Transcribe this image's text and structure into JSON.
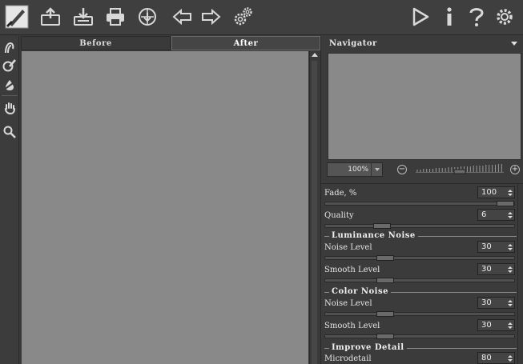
{
  "toolbar": {
    "buttons": [
      {
        "name": "app-logo-icon"
      },
      {
        "name": "open-icon"
      },
      {
        "name": "save-icon"
      },
      {
        "name": "print-icon"
      },
      {
        "name": "share-icon"
      },
      {
        "name": "undo-arrow-icon"
      },
      {
        "name": "redo-arrow-icon"
      },
      {
        "name": "settings-gears-icon"
      },
      {
        "name": "run-icon"
      },
      {
        "name": "info-icon"
      },
      {
        "name": "help-icon"
      },
      {
        "name": "preferences-icon"
      }
    ]
  },
  "tools": [
    "smudge-icon",
    "history-brush-icon",
    "eraser-icon",
    "hand-icon",
    "zoom-icon"
  ],
  "tabs": {
    "before": "Before",
    "after": "After"
  },
  "navigator": {
    "title": "Navigator",
    "zoom_value": "100%",
    "zoom_level": 0.5
  },
  "settings": {
    "fade": {
      "label": "Fade, %",
      "value": "100",
      "level": 1.0
    },
    "quality": {
      "label": "Quality",
      "value": "6",
      "level": 0.28
    },
    "luminance_noise": {
      "title": "Luminance Noise",
      "noise_level": {
        "label": "Noise Level",
        "value": "30",
        "level": 0.3
      },
      "smooth_level": {
        "label": "Smooth Level",
        "value": "30",
        "level": 0.3
      }
    },
    "color_noise": {
      "title": "Color Noise",
      "noise_level": {
        "label": "Noise Level",
        "value": "30",
        "level": 0.3
      },
      "smooth_level": {
        "label": "Smooth Level",
        "value": "30",
        "level": 0.3
      }
    },
    "improve_detail": {
      "title": "Improve Detail",
      "microdetail": {
        "label": "Microdetail",
        "value": "80"
      }
    }
  },
  "colors": {
    "background": "#3a3a3a",
    "canvas": "#898989",
    "text": "#e8e8e8"
  }
}
